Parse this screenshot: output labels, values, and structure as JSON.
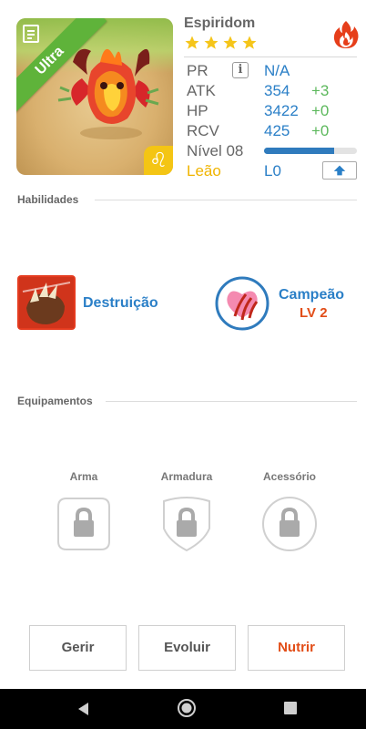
{
  "monster": {
    "name": "Espiridom",
    "rarity_badge": "Ultra",
    "stars": 4,
    "zodiac_symbol": "♌",
    "element_icon": "fire-icon"
  },
  "stats": {
    "pr": {
      "label": "PR",
      "value": "N/A"
    },
    "atk": {
      "label": "ATK",
      "value": "354",
      "bonus": "+3"
    },
    "hp": {
      "label": "HP",
      "value": "3422",
      "bonus": "+0"
    },
    "rcv": {
      "label": "RCV",
      "value": "425",
      "bonus": "+0"
    },
    "level": {
      "label": "Nível 08",
      "progress": 0.75
    },
    "zodiac": {
      "label": "Leão",
      "value": "L0"
    }
  },
  "sections": {
    "skills": "Habilidades",
    "equipment": "Equipamentos"
  },
  "skills": {
    "active": {
      "name": "Destruição"
    },
    "leader": {
      "name": "Campeão",
      "level": "LV 2"
    }
  },
  "equipment": {
    "slots": [
      {
        "label": "Arma"
      },
      {
        "label": "Armadura"
      },
      {
        "label": "Acessório"
      }
    ]
  },
  "actions": {
    "manage": "Gerir",
    "evolve": "Evoluir",
    "feed": "Nutrir"
  },
  "colors": {
    "accent_blue": "#2a7fc7",
    "bonus_green": "#5cb85c",
    "highlight_orange": "#e24d17",
    "zodiac_yellow": "#f0b400",
    "ribbon_green": "#5fb33a"
  }
}
